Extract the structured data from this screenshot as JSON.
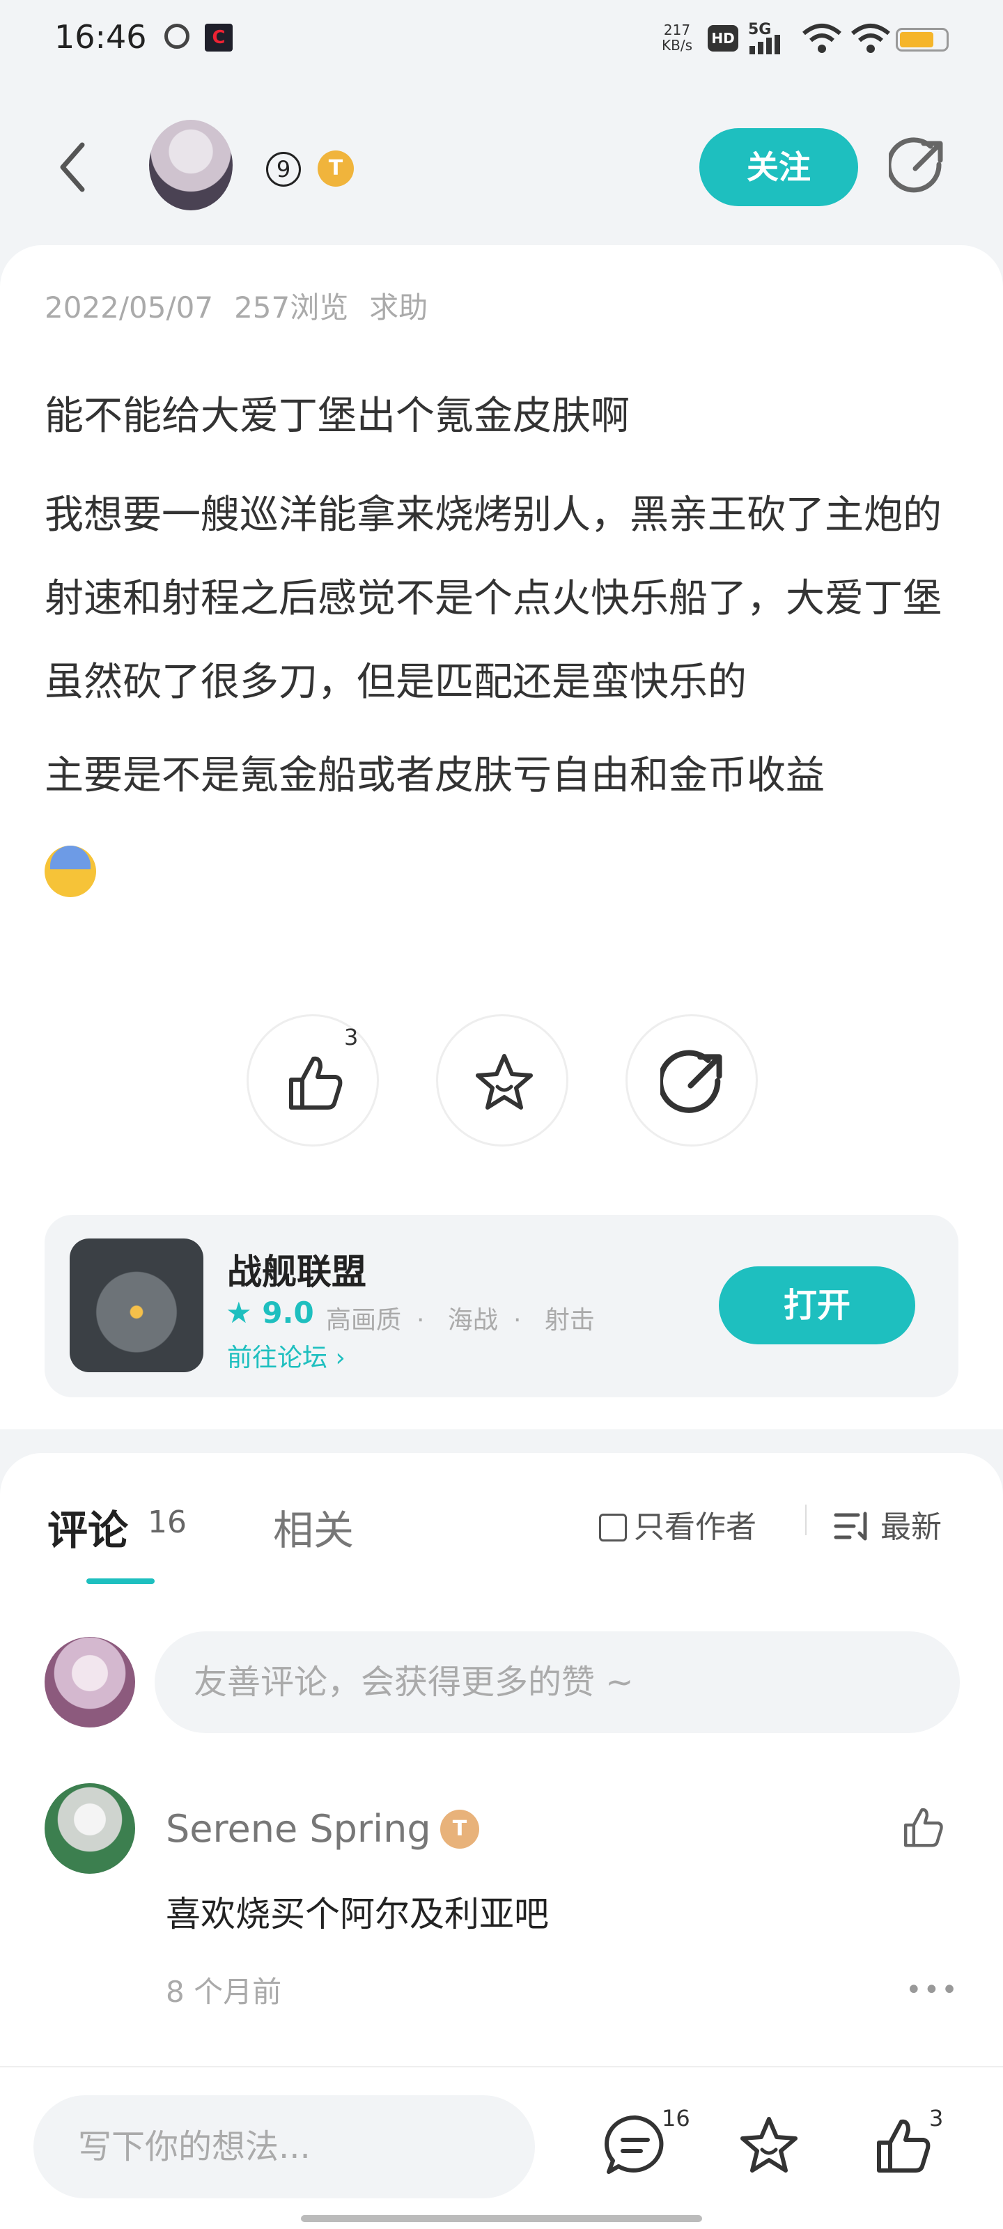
{
  "status": {
    "time": "16:46",
    "net_speed": "217\nKB/s",
    "net_speed_top": "217",
    "net_speed_bottom": "KB/s",
    "hd": "HD",
    "signal": "5G"
  },
  "header": {
    "level": "9",
    "title_badge": "T",
    "follow_label": "关注"
  },
  "post": {
    "date": "2022/05/07",
    "views": "257浏览",
    "category": "求助",
    "title": "能不能给大爱丁堡出个氪金皮肤啊",
    "paragraph1": "我想要一艘巡洋能拿来烧烤别人，黑亲王砍了主炮的射速和射程之后感觉不是个点火快乐船了，大爱丁堡虽然砍了很多刀，但是匹配还是蛮快乐的",
    "paragraph2": "主要是不是氪金船或者皮肤亏自由和金币收益",
    "like_count": "3"
  },
  "game": {
    "name": "战舰联盟",
    "score": "9.0",
    "tags": [
      "高画质",
      "海战",
      "射击"
    ],
    "forum_link": "前往论坛",
    "open_label": "打开"
  },
  "comments": {
    "tab_label": "评论",
    "count": "16",
    "related_label": "相关",
    "only_author_label": "只看作者",
    "sort_label": "最新",
    "input_placeholder": "友善评论，会获得更多的赞 ~",
    "items": [
      {
        "user": "Serene Spring",
        "badge": "T",
        "text": "喜欢烧买个阿尔及利亚吧",
        "time": "8 个月前"
      }
    ]
  },
  "bottom_bar": {
    "input_placeholder": "写下你的想法...",
    "comment_count": "16",
    "like_count": "3"
  },
  "colors": {
    "accent": "#1ebfbf",
    "badge_gold": "#f0b43c"
  }
}
